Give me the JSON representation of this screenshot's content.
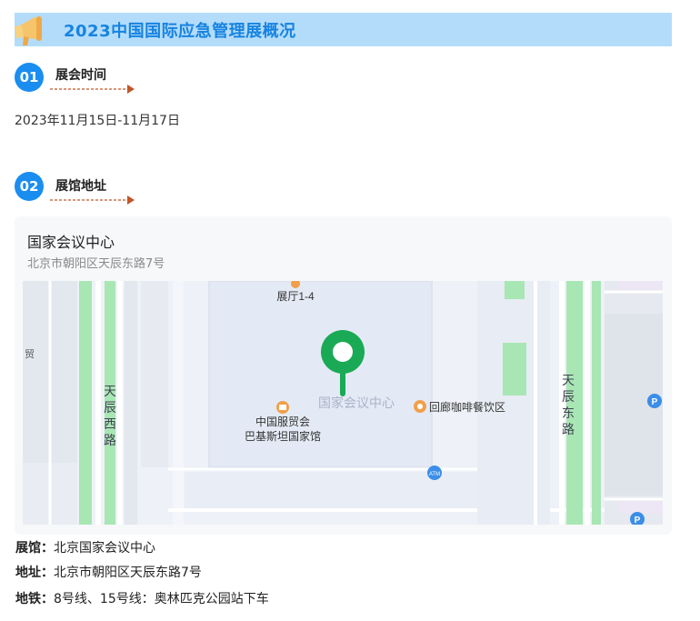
{
  "header": {
    "title": "2023中国国际应急管理展概况",
    "icon": "megaphone-icon"
  },
  "sections": [
    {
      "number": "01",
      "title": "展会时间"
    },
    {
      "number": "02",
      "title": "展馆地址"
    }
  ],
  "exhibition_date": "2023年11月15日-11月17日",
  "location_card": {
    "name": "国家会议中心",
    "address": "北京市朝阳区天辰东路7号",
    "map": {
      "labels": {
        "hall": "展厅1-4",
        "center": "国家会议中心",
        "cafe": "回廊咖啡餐饮区",
        "museum_line1": "中国服贸会",
        "museum_line2": "巴基斯坦国家馆",
        "road_west": "天辰西路",
        "road_east": "天辰东路",
        "edge_left": "贸",
        "atm": "ATM",
        "parking": "P"
      },
      "colors": {
        "pin": "#1aaa55",
        "road_green": "#a8e6b4",
        "building": "#e4eaf5",
        "poi_orange": "#f0a04a"
      }
    }
  },
  "details": [
    {
      "label": "展馆：",
      "value": "北京国家会议中心"
    },
    {
      "label": "地址：",
      "value": "北京市朝阳区天辰东路7号"
    },
    {
      "label": "地铁：",
      "value": "8号线、15号线：奥林匹克公园站下车"
    }
  ],
  "colors": {
    "accent": "#1a8df0",
    "title_bg": "#b3dcfb",
    "title_text": "#1783e0",
    "arrow": "#c0572a"
  }
}
